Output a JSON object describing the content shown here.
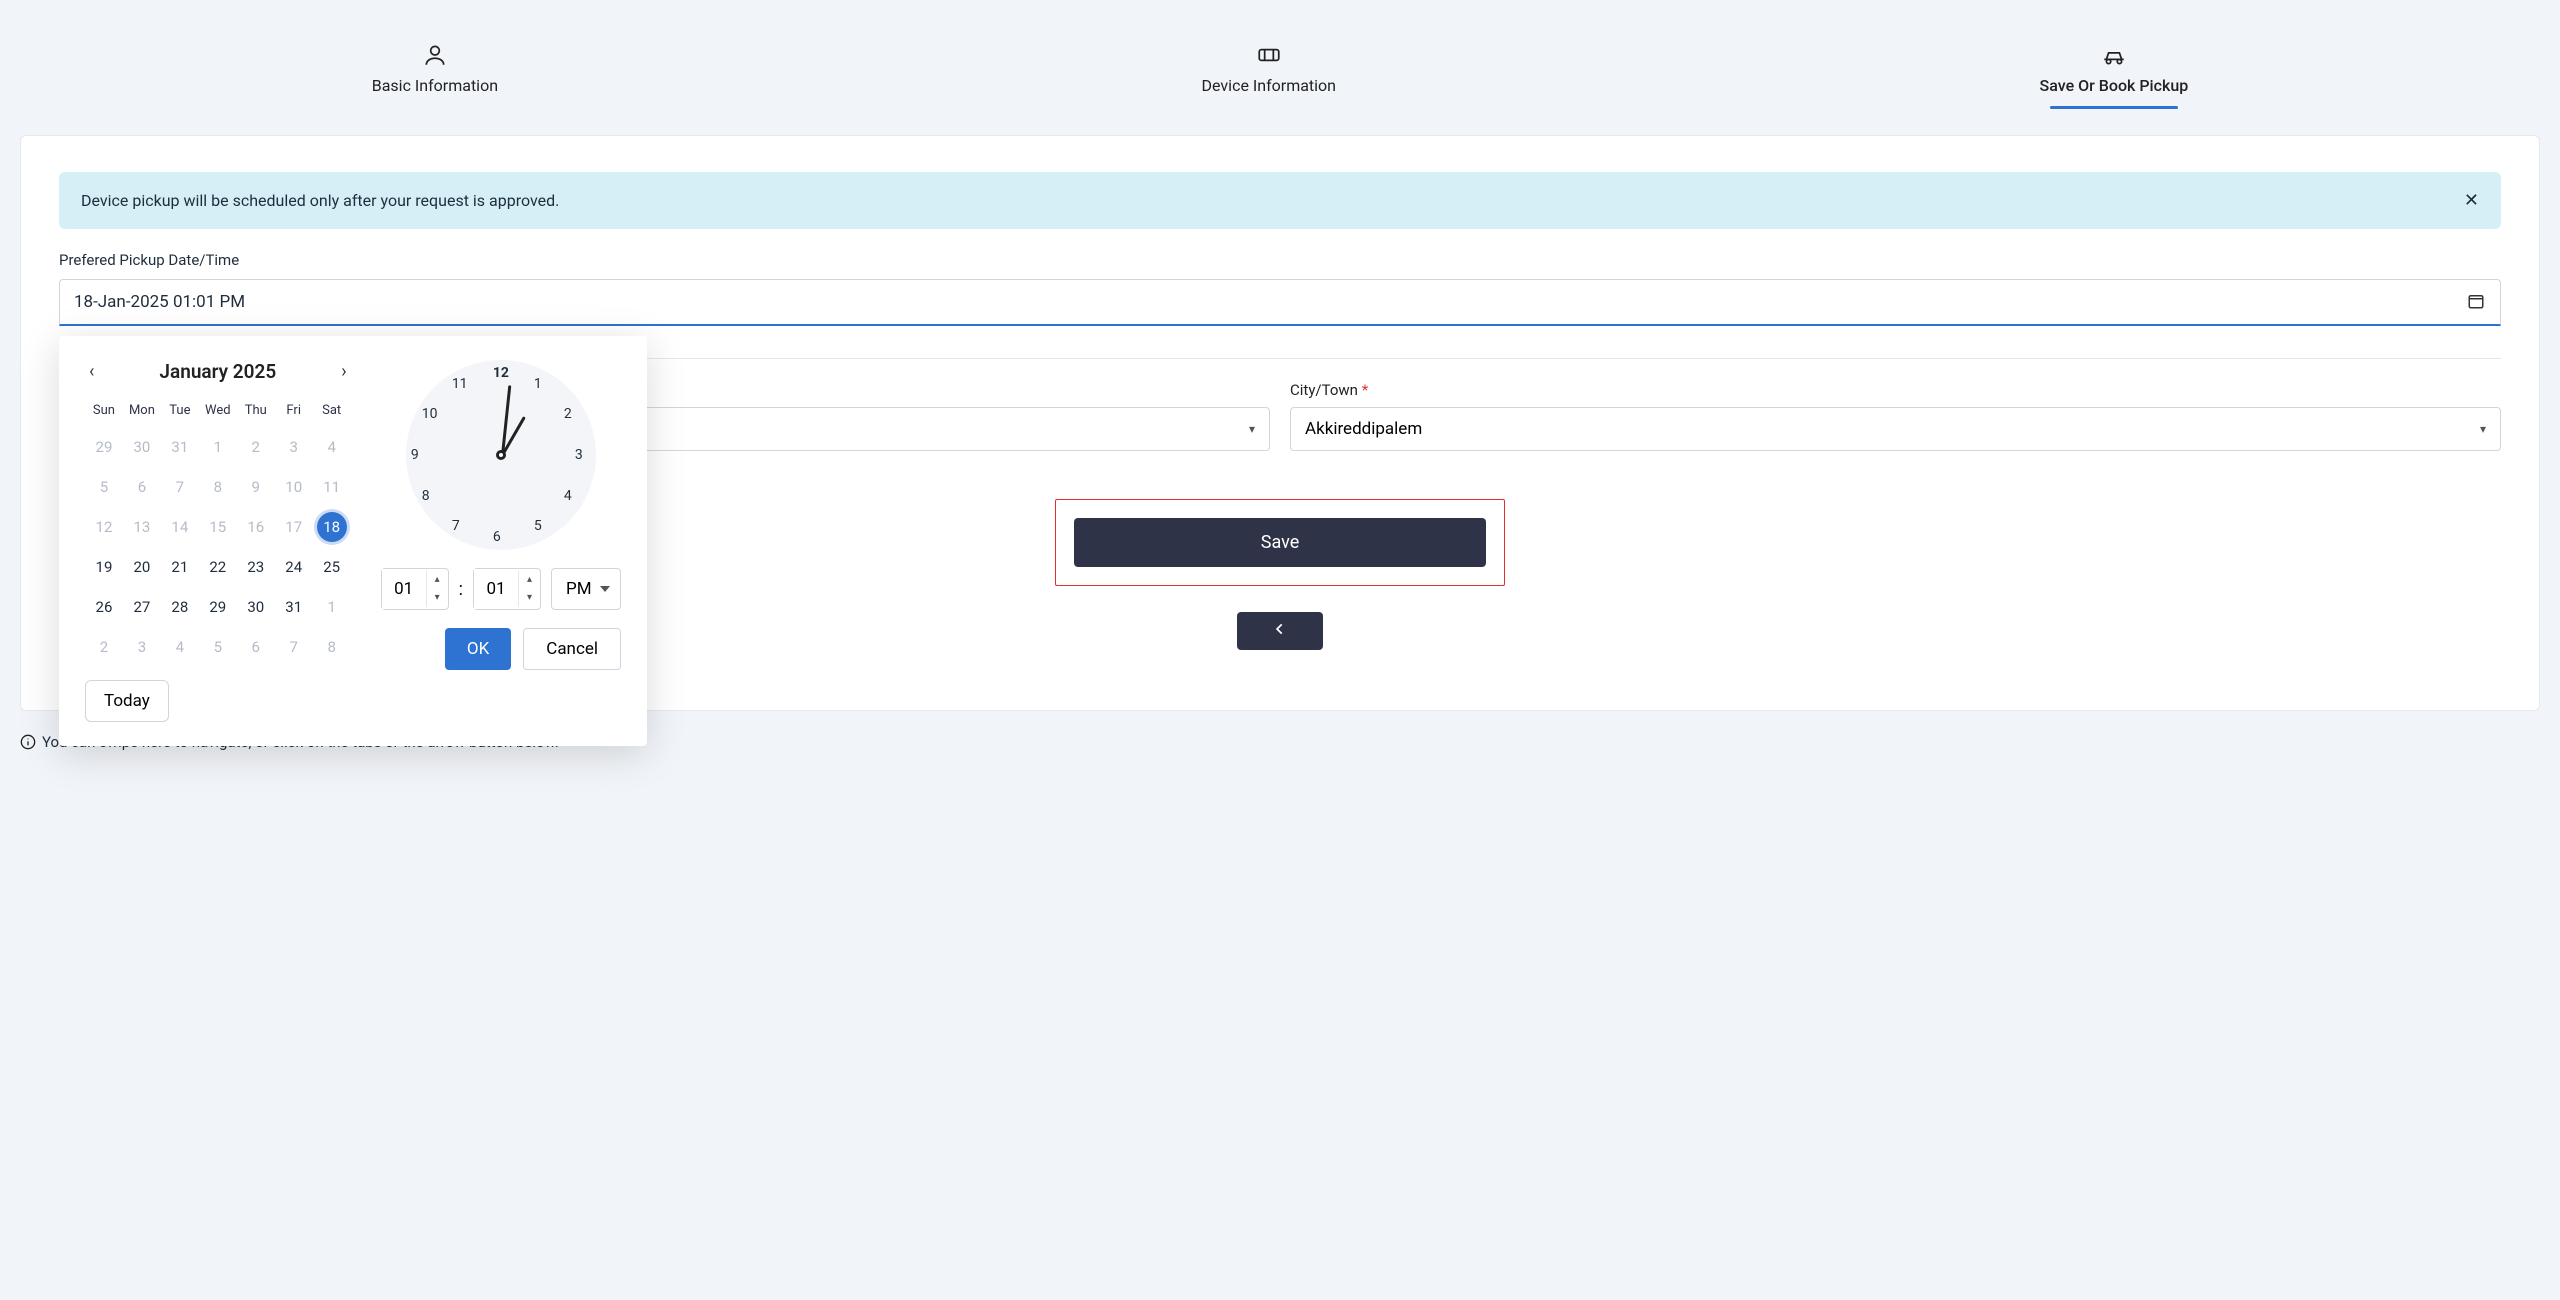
{
  "stepper": {
    "steps": [
      {
        "label": "Basic Information"
      },
      {
        "label": "Device Information"
      },
      {
        "label": "Save Or Book Pickup"
      }
    ]
  },
  "notice": {
    "text": "Device pickup will be scheduled only after your request is approved."
  },
  "field": {
    "label": "Prefered Pickup Date/Time",
    "value": "18-Jan-2025 01:01 PM"
  },
  "address": {
    "city_label": "City/Town",
    "city_value": "Akkireddipalem"
  },
  "buttons": {
    "save": "Save",
    "today": "Today",
    "ok": "OK",
    "cancel": "Cancel"
  },
  "hint": "You can swipe here to navigate, or click on the tabs or the arrow button below.",
  "picker": {
    "month_title": "January 2025",
    "dow": [
      "Sun",
      "Mon",
      "Tue",
      "Wed",
      "Thu",
      "Fri",
      "Sat"
    ],
    "weeks": [
      [
        {
          "n": "29",
          "muted": true
        },
        {
          "n": "30",
          "muted": true
        },
        {
          "n": "31",
          "muted": true
        },
        {
          "n": "1",
          "muted": true
        },
        {
          "n": "2",
          "muted": true
        },
        {
          "n": "3",
          "muted": true
        },
        {
          "n": "4",
          "muted": true
        }
      ],
      [
        {
          "n": "5",
          "muted": true
        },
        {
          "n": "6",
          "muted": true
        },
        {
          "n": "7",
          "muted": true
        },
        {
          "n": "8",
          "muted": true
        },
        {
          "n": "9",
          "muted": true
        },
        {
          "n": "10",
          "muted": true
        },
        {
          "n": "11",
          "muted": true
        }
      ],
      [
        {
          "n": "12",
          "muted": true
        },
        {
          "n": "13",
          "muted": true
        },
        {
          "n": "14",
          "muted": true
        },
        {
          "n": "15",
          "muted": true
        },
        {
          "n": "16",
          "muted": true
        },
        {
          "n": "17",
          "muted": true
        },
        {
          "n": "18",
          "sel": true
        }
      ],
      [
        {
          "n": "19"
        },
        {
          "n": "20"
        },
        {
          "n": "21"
        },
        {
          "n": "22"
        },
        {
          "n": "23"
        },
        {
          "n": "24"
        },
        {
          "n": "25"
        }
      ],
      [
        {
          "n": "26"
        },
        {
          "n": "27"
        },
        {
          "n": "28"
        },
        {
          "n": "29"
        },
        {
          "n": "30"
        },
        {
          "n": "31"
        },
        {
          "n": "1",
          "muted": true
        }
      ],
      [
        {
          "n": "2",
          "muted": true
        },
        {
          "n": "3",
          "muted": true
        },
        {
          "n": "4",
          "muted": true
        },
        {
          "n": "5",
          "muted": true
        },
        {
          "n": "6",
          "muted": true
        },
        {
          "n": "7",
          "muted": true
        },
        {
          "n": "8",
          "muted": true
        }
      ]
    ],
    "clock_numbers": [
      "12",
      "1",
      "2",
      "3",
      "4",
      "5",
      "6",
      "7",
      "8",
      "9",
      "10",
      "11"
    ],
    "hour": "01",
    "minute": "01",
    "ampm": "PM"
  }
}
